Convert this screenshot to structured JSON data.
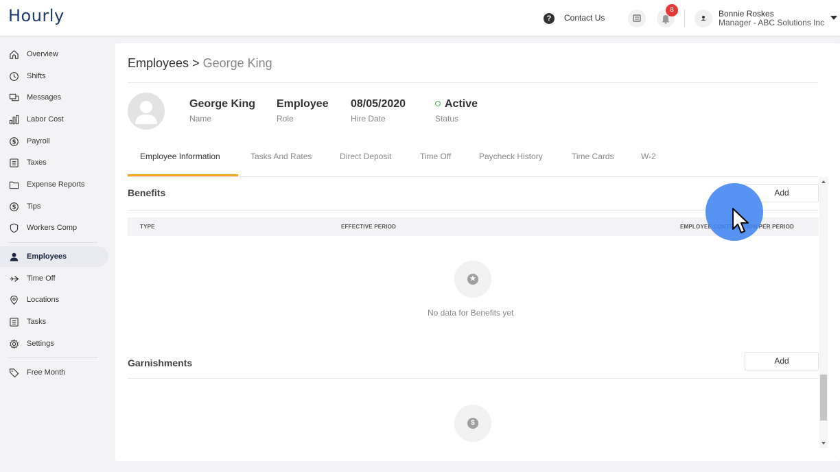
{
  "header": {
    "logo": "Hourly",
    "help_glyph": "?",
    "contact_label": "Contact Us",
    "notification_count": "8",
    "user_name": "Bonnie Roskes",
    "user_role": "Manager - ABC Solutions Inc"
  },
  "sidebar": {
    "items": [
      {
        "label": "Overview",
        "icon": "home-icon"
      },
      {
        "label": "Shifts",
        "icon": "clock-icon"
      },
      {
        "label": "Messages",
        "icon": "messages-icon"
      },
      {
        "label": "Labor Cost",
        "icon": "bar-chart-icon"
      },
      {
        "label": "Payroll",
        "icon": "dollar-circle-icon"
      },
      {
        "label": "Taxes",
        "icon": "document-icon"
      },
      {
        "label": "Expense Reports",
        "icon": "folder-icon"
      },
      {
        "label": "Tips",
        "icon": "dollar-circle-icon"
      },
      {
        "label": "Workers Comp",
        "icon": "shield-icon"
      },
      {
        "label": "Employees",
        "icon": "person-icon",
        "active": true
      },
      {
        "label": "Time Off",
        "icon": "plane-icon"
      },
      {
        "label": "Locations",
        "icon": "location-pin-icon"
      },
      {
        "label": "Tasks",
        "icon": "document-icon"
      },
      {
        "label": "Settings",
        "icon": "gear-icon"
      },
      {
        "label": "Free Month",
        "icon": "tag-icon"
      }
    ]
  },
  "breadcrumb": {
    "parent": "Employees",
    "separator": ">",
    "current": "George King"
  },
  "employee": {
    "name": "George King",
    "name_label": "Name",
    "role": "Employee",
    "role_label": "Role",
    "hire_date": "08/05/2020",
    "hire_date_label": "Hire Date",
    "status": "Active",
    "status_label": "Status",
    "status_color": "#4caf50"
  },
  "tabs": [
    {
      "label": "Employee Information",
      "active": true
    },
    {
      "label": "Tasks And Rates"
    },
    {
      "label": "Direct Deposit"
    },
    {
      "label": "Time Off"
    },
    {
      "label": "Paycheck History"
    },
    {
      "label": "Time Cards"
    },
    {
      "label": "W-2"
    }
  ],
  "benefits": {
    "title": "Benefits",
    "add_label": "Add",
    "columns": [
      "TYPE",
      "EFFECTIVE PERIOD",
      "EMPLOYEE CONTRIBUTION PER PERIOD"
    ],
    "empty_icon": "star-icon",
    "empty_glyph": "★",
    "empty_text": "No data for Benefits yet"
  },
  "garnishments": {
    "title": "Garnishments",
    "add_label": "Add",
    "empty_icon": "dollar-icon",
    "empty_glyph": "$"
  },
  "colors": {
    "brand": "#1e3a6e",
    "tab_accent": "#f5a623",
    "badge": "#e53935",
    "click_highlight": "#4084f0"
  }
}
